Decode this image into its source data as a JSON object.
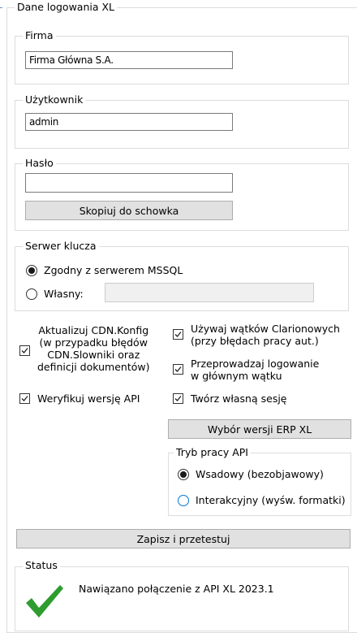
{
  "login_group": {
    "title": "Dane logowania XL"
  },
  "firma": {
    "label": "Firma",
    "value": "Firma Główna S.A."
  },
  "uzytkownik": {
    "label": "Użytkownik",
    "value": "admin"
  },
  "haslo": {
    "label": "Hasło",
    "value": "",
    "copy_button": "Skopiuj do schowka"
  },
  "serwer": {
    "label": "Serwer klucza",
    "option_mssql": "Zgodny z serwerem MSSQL",
    "option_own": "Własny:",
    "own_value": "",
    "selected": "mssql"
  },
  "options": {
    "aktualizuj": {
      "label": [
        "Aktualizuj CDN.Konfig",
        "(w przypadku błędów",
        "CDN.Slowniki oraz",
        "definicji dokumentów)"
      ],
      "checked": true
    },
    "weryfikuj": {
      "label": "Weryfikuj wersję API",
      "checked": true
    },
    "watki": {
      "label": [
        "Używaj wątków Clarionowych",
        "(przy błędach pracy aut.)"
      ],
      "checked": true
    },
    "glowny": {
      "label": [
        "Przeprowadzaj logowanie",
        "w głównym wątku"
      ],
      "checked": true
    },
    "sesja": {
      "label": "Twórz własną sesję",
      "checked": true
    }
  },
  "erp_button": "Wybór wersji ERP XL",
  "tryb": {
    "label": "Tryb pracy API",
    "option_wsadowy": "Wsadowy (bezobjawowy)",
    "option_interaktywny": "Interakcyjny (wyśw. formatki)",
    "selected": "wsadowy"
  },
  "save_button": "Zapisz i przetestuj",
  "status": {
    "label": "Status",
    "message": "Nawiązano połączenie z API XL 2023.1"
  },
  "colors": {
    "accent": "#0078d7",
    "success": "#2e9c2e",
    "button_bg": "#e1e1e1"
  },
  "icons": {
    "status": "checkmark-icon"
  }
}
